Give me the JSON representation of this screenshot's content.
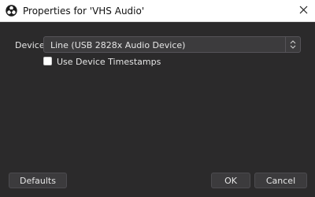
{
  "window": {
    "title": "Properties for 'VHS Audio'",
    "app_icon": "obs-logo-icon",
    "close_icon": "close-icon"
  },
  "properties": {
    "device_label": "Device",
    "device_value": "Line (USB 2828x Audio Device)",
    "device_arrow_icon": "updown-chevron-icon",
    "timestamps_label": "Use Device Timestamps",
    "timestamps_checked": false
  },
  "buttons": {
    "defaults": "Defaults",
    "ok": "OK",
    "cancel": "Cancel"
  },
  "colors": {
    "dialog_background": "#2b2a2b",
    "control_background": "#3c3b3d",
    "text": "#e6e6e6",
    "titlebar": "#ffffff"
  }
}
